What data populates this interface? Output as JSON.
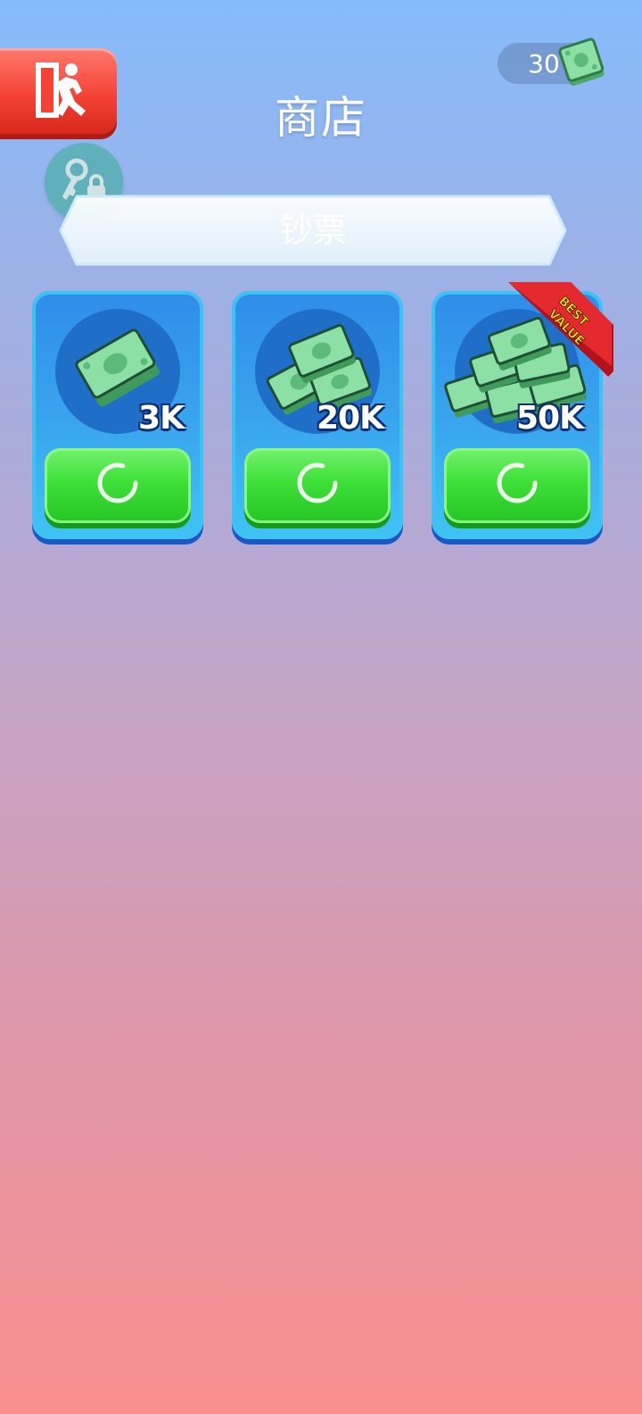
{
  "header": {
    "title": "商店",
    "exit_icon": "exit-running-man-icon",
    "key_icon": "key-lock-icon"
  },
  "currency": {
    "value": "30",
    "icon": "cash-stack-icon"
  },
  "tab": {
    "label": "钞票"
  },
  "products": [
    {
      "amount": "3K",
      "icon": "cash-single-icon",
      "badge": ""
    },
    {
      "amount": "20K",
      "icon": "cash-pile-icon",
      "badge": ""
    },
    {
      "amount": "50K",
      "icon": "cash-mountain-icon",
      "badge": "BEST VALUE"
    }
  ],
  "badge_lines": [
    "BEST",
    "VALUE"
  ],
  "colors": {
    "exit_button": "#f44336",
    "card": "#2f8de8",
    "buy_button": "#3ee038",
    "cash": "#7ed39a"
  }
}
